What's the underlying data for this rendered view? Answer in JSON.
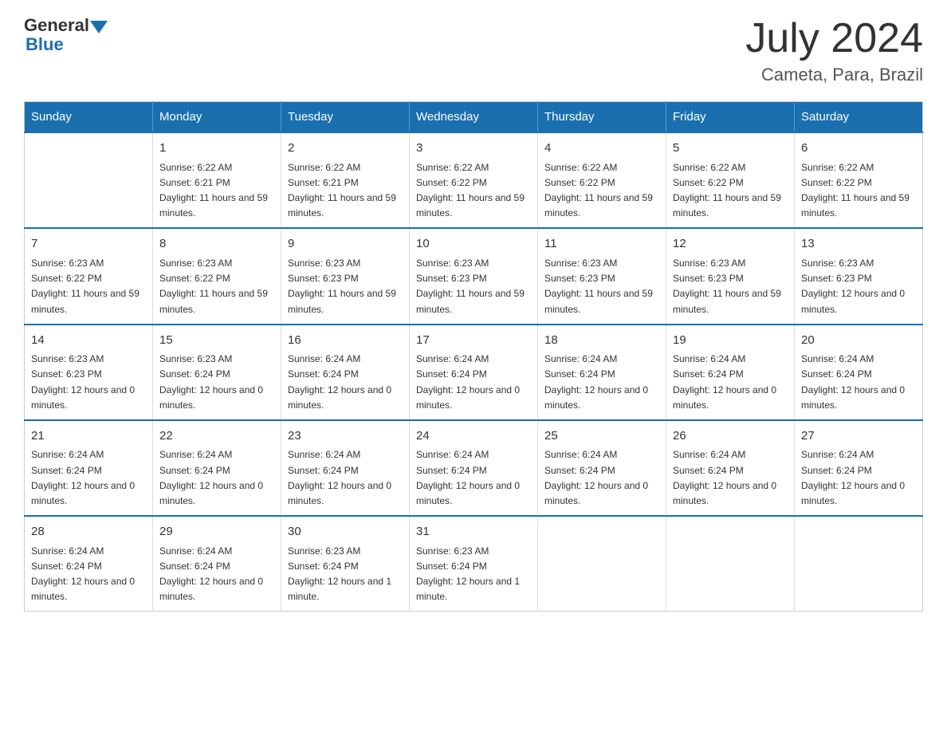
{
  "logo": {
    "general": "General",
    "blue": "Blue"
  },
  "header": {
    "month": "July 2024",
    "location": "Cameta, Para, Brazil"
  },
  "weekdays": [
    "Sunday",
    "Monday",
    "Tuesday",
    "Wednesday",
    "Thursday",
    "Friday",
    "Saturday"
  ],
  "weeks": [
    [
      {
        "day": "",
        "sunrise": "",
        "sunset": "",
        "daylight": ""
      },
      {
        "day": "1",
        "sunrise": "Sunrise: 6:22 AM",
        "sunset": "Sunset: 6:21 PM",
        "daylight": "Daylight: 11 hours and 59 minutes."
      },
      {
        "day": "2",
        "sunrise": "Sunrise: 6:22 AM",
        "sunset": "Sunset: 6:21 PM",
        "daylight": "Daylight: 11 hours and 59 minutes."
      },
      {
        "day": "3",
        "sunrise": "Sunrise: 6:22 AM",
        "sunset": "Sunset: 6:22 PM",
        "daylight": "Daylight: 11 hours and 59 minutes."
      },
      {
        "day": "4",
        "sunrise": "Sunrise: 6:22 AM",
        "sunset": "Sunset: 6:22 PM",
        "daylight": "Daylight: 11 hours and 59 minutes."
      },
      {
        "day": "5",
        "sunrise": "Sunrise: 6:22 AM",
        "sunset": "Sunset: 6:22 PM",
        "daylight": "Daylight: 11 hours and 59 minutes."
      },
      {
        "day": "6",
        "sunrise": "Sunrise: 6:22 AM",
        "sunset": "Sunset: 6:22 PM",
        "daylight": "Daylight: 11 hours and 59 minutes."
      }
    ],
    [
      {
        "day": "7",
        "sunrise": "Sunrise: 6:23 AM",
        "sunset": "Sunset: 6:22 PM",
        "daylight": "Daylight: 11 hours and 59 minutes."
      },
      {
        "day": "8",
        "sunrise": "Sunrise: 6:23 AM",
        "sunset": "Sunset: 6:22 PM",
        "daylight": "Daylight: 11 hours and 59 minutes."
      },
      {
        "day": "9",
        "sunrise": "Sunrise: 6:23 AM",
        "sunset": "Sunset: 6:23 PM",
        "daylight": "Daylight: 11 hours and 59 minutes."
      },
      {
        "day": "10",
        "sunrise": "Sunrise: 6:23 AM",
        "sunset": "Sunset: 6:23 PM",
        "daylight": "Daylight: 11 hours and 59 minutes."
      },
      {
        "day": "11",
        "sunrise": "Sunrise: 6:23 AM",
        "sunset": "Sunset: 6:23 PM",
        "daylight": "Daylight: 11 hours and 59 minutes."
      },
      {
        "day": "12",
        "sunrise": "Sunrise: 6:23 AM",
        "sunset": "Sunset: 6:23 PM",
        "daylight": "Daylight: 11 hours and 59 minutes."
      },
      {
        "day": "13",
        "sunrise": "Sunrise: 6:23 AM",
        "sunset": "Sunset: 6:23 PM",
        "daylight": "Daylight: 12 hours and 0 minutes."
      }
    ],
    [
      {
        "day": "14",
        "sunrise": "Sunrise: 6:23 AM",
        "sunset": "Sunset: 6:23 PM",
        "daylight": "Daylight: 12 hours and 0 minutes."
      },
      {
        "day": "15",
        "sunrise": "Sunrise: 6:23 AM",
        "sunset": "Sunset: 6:24 PM",
        "daylight": "Daylight: 12 hours and 0 minutes."
      },
      {
        "day": "16",
        "sunrise": "Sunrise: 6:24 AM",
        "sunset": "Sunset: 6:24 PM",
        "daylight": "Daylight: 12 hours and 0 minutes."
      },
      {
        "day": "17",
        "sunrise": "Sunrise: 6:24 AM",
        "sunset": "Sunset: 6:24 PM",
        "daylight": "Daylight: 12 hours and 0 minutes."
      },
      {
        "day": "18",
        "sunrise": "Sunrise: 6:24 AM",
        "sunset": "Sunset: 6:24 PM",
        "daylight": "Daylight: 12 hours and 0 minutes."
      },
      {
        "day": "19",
        "sunrise": "Sunrise: 6:24 AM",
        "sunset": "Sunset: 6:24 PM",
        "daylight": "Daylight: 12 hours and 0 minutes."
      },
      {
        "day": "20",
        "sunrise": "Sunrise: 6:24 AM",
        "sunset": "Sunset: 6:24 PM",
        "daylight": "Daylight: 12 hours and 0 minutes."
      }
    ],
    [
      {
        "day": "21",
        "sunrise": "Sunrise: 6:24 AM",
        "sunset": "Sunset: 6:24 PM",
        "daylight": "Daylight: 12 hours and 0 minutes."
      },
      {
        "day": "22",
        "sunrise": "Sunrise: 6:24 AM",
        "sunset": "Sunset: 6:24 PM",
        "daylight": "Daylight: 12 hours and 0 minutes."
      },
      {
        "day": "23",
        "sunrise": "Sunrise: 6:24 AM",
        "sunset": "Sunset: 6:24 PM",
        "daylight": "Daylight: 12 hours and 0 minutes."
      },
      {
        "day": "24",
        "sunrise": "Sunrise: 6:24 AM",
        "sunset": "Sunset: 6:24 PM",
        "daylight": "Daylight: 12 hours and 0 minutes."
      },
      {
        "day": "25",
        "sunrise": "Sunrise: 6:24 AM",
        "sunset": "Sunset: 6:24 PM",
        "daylight": "Daylight: 12 hours and 0 minutes."
      },
      {
        "day": "26",
        "sunrise": "Sunrise: 6:24 AM",
        "sunset": "Sunset: 6:24 PM",
        "daylight": "Daylight: 12 hours and 0 minutes."
      },
      {
        "day": "27",
        "sunrise": "Sunrise: 6:24 AM",
        "sunset": "Sunset: 6:24 PM",
        "daylight": "Daylight: 12 hours and 0 minutes."
      }
    ],
    [
      {
        "day": "28",
        "sunrise": "Sunrise: 6:24 AM",
        "sunset": "Sunset: 6:24 PM",
        "daylight": "Daylight: 12 hours and 0 minutes."
      },
      {
        "day": "29",
        "sunrise": "Sunrise: 6:24 AM",
        "sunset": "Sunset: 6:24 PM",
        "daylight": "Daylight: 12 hours and 0 minutes."
      },
      {
        "day": "30",
        "sunrise": "Sunrise: 6:23 AM",
        "sunset": "Sunset: 6:24 PM",
        "daylight": "Daylight: 12 hours and 1 minute."
      },
      {
        "day": "31",
        "sunrise": "Sunrise: 6:23 AM",
        "sunset": "Sunset: 6:24 PM",
        "daylight": "Daylight: 12 hours and 1 minute."
      },
      {
        "day": "",
        "sunrise": "",
        "sunset": "",
        "daylight": ""
      },
      {
        "day": "",
        "sunrise": "",
        "sunset": "",
        "daylight": ""
      },
      {
        "day": "",
        "sunrise": "",
        "sunset": "",
        "daylight": ""
      }
    ]
  ]
}
